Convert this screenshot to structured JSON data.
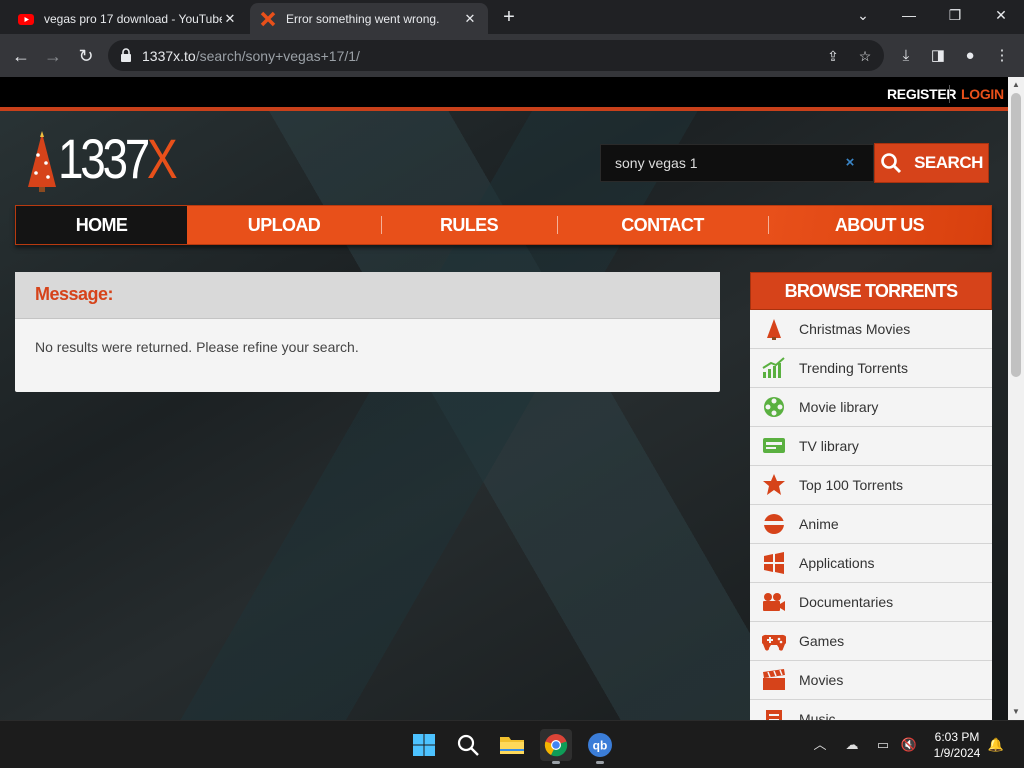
{
  "browser": {
    "tabs": [
      {
        "title": "vegas pro 17 download - YouTube",
        "active": false
      },
      {
        "title": "Error something went wrong.",
        "active": true
      }
    ],
    "url_host": "1337x.to",
    "url_path": "/search/sony+vegas+17/1/"
  },
  "site": {
    "top_links": {
      "register": "REGISTER",
      "login": "LOGIN"
    },
    "logo": {
      "text_main": "1337",
      "text_accent": "X"
    },
    "search": {
      "value": "sony vegas 1",
      "button_label": "SEARCH",
      "clear_label": "×"
    },
    "nav": [
      {
        "label": "HOME",
        "active": true
      },
      {
        "label": "UPLOAD"
      },
      {
        "label": "RULES"
      },
      {
        "label": "CONTACT"
      },
      {
        "label": "ABOUT US"
      }
    ],
    "message": {
      "title": "Message:",
      "body": "No results were returned. Please refine your search."
    },
    "browse": {
      "title": "BROWSE TORRENTS",
      "items": [
        {
          "label": "Christmas Movies",
          "icon": "christmas-tree-icon"
        },
        {
          "label": "Trending Torrents",
          "icon": "trending-chart-icon"
        },
        {
          "label": "Movie library",
          "icon": "film-reel-icon"
        },
        {
          "label": "TV library",
          "icon": "tv-icon"
        },
        {
          "label": "Top 100 Torrents",
          "icon": "top-badge-icon"
        },
        {
          "label": "Anime",
          "icon": "anime-icon"
        },
        {
          "label": "Applications",
          "icon": "windows-logo-icon"
        },
        {
          "label": "Documentaries",
          "icon": "camera-icon"
        },
        {
          "label": "Games",
          "icon": "gamepad-icon"
        },
        {
          "label": "Movies",
          "icon": "clapperboard-icon"
        },
        {
          "label": "Music",
          "icon": "music-icon"
        }
      ]
    }
  },
  "taskbar": {
    "time": "6:03 PM",
    "date": "1/9/2024",
    "qb_label": "qb"
  },
  "colors": {
    "accent": "#e8501a",
    "accent_dark": "#d6431a",
    "nav_active": "#141414"
  }
}
